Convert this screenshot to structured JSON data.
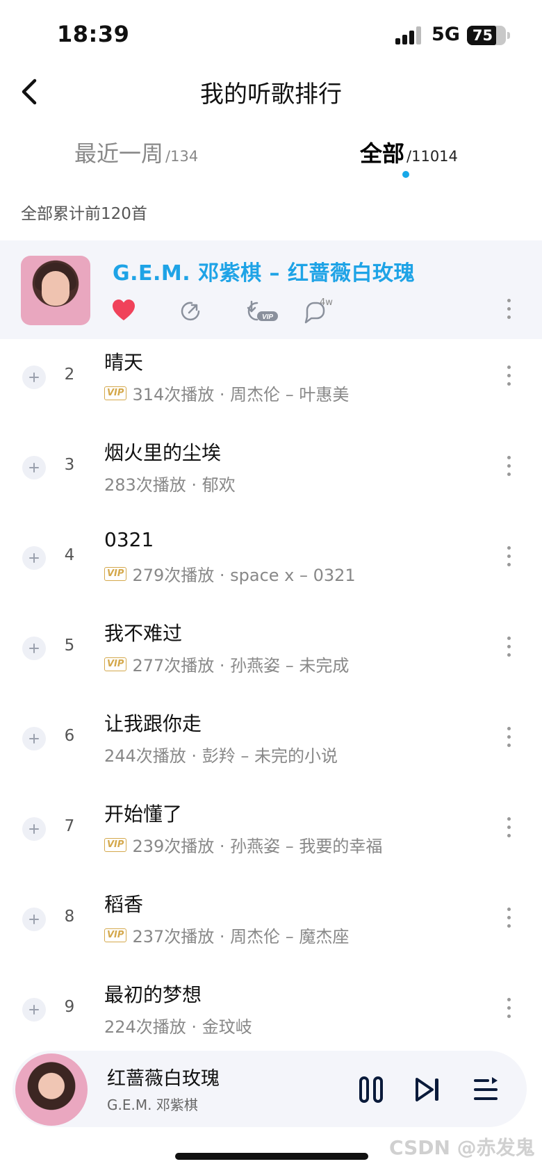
{
  "status_bar": {
    "time": "18:39",
    "network": "5G",
    "battery": "75",
    "battery_level": 0.75
  },
  "header": {
    "title": "我的听歌排行"
  },
  "tabs": [
    {
      "label": "最近一周",
      "count": "/134",
      "active": false
    },
    {
      "label": "全部",
      "count": "/11014",
      "active": true
    }
  ],
  "summary": "全部累计前120首",
  "top_song": {
    "title": "G.E.M. 邓紫棋 – 红蔷薇白玫瑰",
    "comment_count": "4w",
    "icons": [
      "heart-icon",
      "share-icon",
      "download-vip-icon",
      "comment-icon",
      "more-icon"
    ]
  },
  "songs": [
    {
      "rank": "2",
      "title": "晴天",
      "vip": true,
      "meta": "314次播放 · 周杰伦 – 叶惠美"
    },
    {
      "rank": "3",
      "title": "烟火里的尘埃",
      "vip": false,
      "meta": "283次播放 · 郁欢"
    },
    {
      "rank": "4",
      "title": "0321",
      "vip": true,
      "meta": "279次播放 · space x – 0321"
    },
    {
      "rank": "5",
      "title": "我不难过",
      "vip": true,
      "meta": "277次播放 · 孙燕姿 – 未完成"
    },
    {
      "rank": "6",
      "title": "让我跟你走",
      "vip": false,
      "meta": "244次播放 · 彭羚 – 未完的小说"
    },
    {
      "rank": "7",
      "title": "开始懂了",
      "vip": true,
      "meta": "239次播放 · 孙燕姿 – 我要的幸福"
    },
    {
      "rank": "8",
      "title": "稻香",
      "vip": true,
      "meta": "237次播放 · 周杰伦 – 魔杰座"
    },
    {
      "rank": "9",
      "title": "最初的梦想",
      "vip": false,
      "meta": "224次播放 · 金玟岐"
    }
  ],
  "vip_label": "VIP",
  "player": {
    "title": "红蔷薇白玫瑰",
    "artist": "G.E.M. 邓紫棋"
  },
  "watermark": "CSDN @赤发鬼",
  "colors": {
    "accent": "#1ea3e6",
    "heart": "#f0425a",
    "vip": "#d4a84b",
    "tab_dot": "#18a8e8"
  }
}
